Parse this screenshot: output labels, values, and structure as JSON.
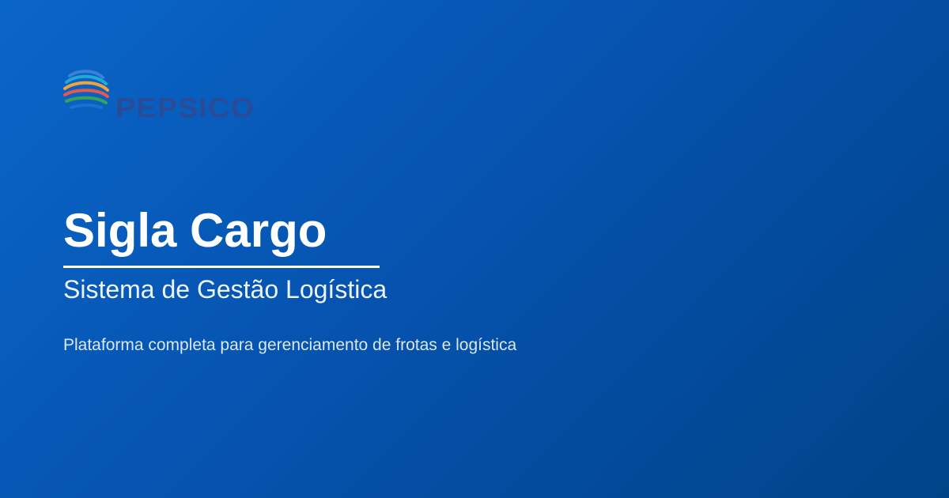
{
  "brand": {
    "logo_text": "PEPSICO",
    "logo_icon": "pepsico-globe-icon"
  },
  "hero": {
    "title": "Sigla Cargo",
    "subtitle": "Sistema de Gestão Logística",
    "description": "Plataforma completa para gerenciamento de frotas e logística"
  },
  "colors": {
    "background_start": "#0a66c8",
    "background_end": "#004488",
    "text": "#ffffff",
    "logo_wordmark": "#2a4c98"
  }
}
